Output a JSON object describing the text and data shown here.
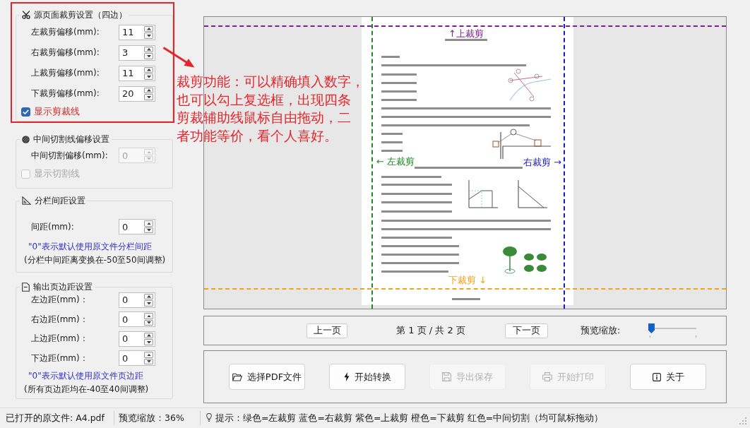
{
  "settings_groups": [
    {
      "title": "源页面裁剪设置（四边）",
      "fields": [
        {
          "label": "左裁剪偏移(mm):",
          "value": "11",
          "disabled": false
        },
        {
          "label": "右裁剪偏移(mm):",
          "value": "3",
          "disabled": false
        },
        {
          "label": "上裁剪偏移(mm):",
          "value": "11",
          "disabled": false
        },
        {
          "label": "下裁剪偏移(mm):",
          "value": "20",
          "disabled": false
        }
      ],
      "checkbox": {
        "label": "显示剪裁线",
        "checked": true,
        "disabled": false
      }
    },
    {
      "title": "中间切割线偏移设置",
      "fields": [
        {
          "label": "中间切割偏移(mm):",
          "value": "0",
          "disabled": true
        }
      ],
      "checkbox": {
        "label": "显示切割线",
        "checked": false,
        "disabled": true
      }
    },
    {
      "title": "分栏间距设置",
      "fields": [
        {
          "label": "间距(mm):",
          "value": "0",
          "disabled": false
        }
      ],
      "notes": [
        {
          "kind": "hint",
          "text": "\"0\"表示默认使用原文件分栏间距"
        },
        {
          "kind": "range",
          "text": "(分栏中间距离变换在-50至50间调整)"
        }
      ]
    },
    {
      "title": "输出页边距设置",
      "fields": [
        {
          "label": "左边距(mm)：",
          "value": "0",
          "disabled": false
        },
        {
          "label": "右边距(mm)：",
          "value": "0",
          "disabled": false
        },
        {
          "label": "上边距(mm)：",
          "value": "0",
          "disabled": false
        },
        {
          "label": "下边距(mm)：",
          "value": "0",
          "disabled": false
        }
      ],
      "notes": [
        {
          "kind": "hint",
          "text": "\"0\"表示默认使用原文件页边距"
        },
        {
          "kind": "range",
          "text": "(所有页边距均在-40至40间调整)"
        }
      ]
    }
  ],
  "preview": {
    "crop_lines": [
      {
        "kind": "top",
        "label": "↑上裁剪",
        "color": "#7e1e94"
      },
      {
        "kind": "left",
        "label": "← 左裁剪",
        "color": "#1f8a24"
      },
      {
        "kind": "right",
        "label": "右裁剪 →",
        "color": "#1a1ac8"
      },
      {
        "kind": "bottom",
        "label": "下裁剪 ↓",
        "color": "#f2a21c"
      }
    ]
  },
  "navigation": {
    "prev_button": "上一页",
    "page_indicator": "第 1 页 / 共 2 页",
    "next_button": "下一页",
    "zoom_label": "预览缩放:",
    "zoom_slider": {
      "level": 0.03
    }
  },
  "actions": [
    {
      "label": "选择PDF文件",
      "disabled": false
    },
    {
      "label": "开始转换",
      "disabled": false
    },
    {
      "label": "导出保存",
      "disabled": true
    },
    {
      "label": "开始打印",
      "disabled": true
    },
    {
      "label": "关于",
      "disabled": false
    }
  ],
  "status_bar": {
    "file": "已打开的原文件: A4.pdf",
    "zoom": "预览缩放：36%",
    "hint": "提示：绿色=左裁剪 蓝色=右裁剪 紫色=上裁剪 橙色=下裁剪 红色=中间切割（均可鼠标拖动）"
  },
  "annotation": {
    "lines": [
      "裁剪功能：可以精确填入数字，",
      "也可以勾上复选框，出现四条",
      "剪裁辅助线鼠标自由拖动，二",
      "者功能等价，看个人喜好。"
    ]
  }
}
